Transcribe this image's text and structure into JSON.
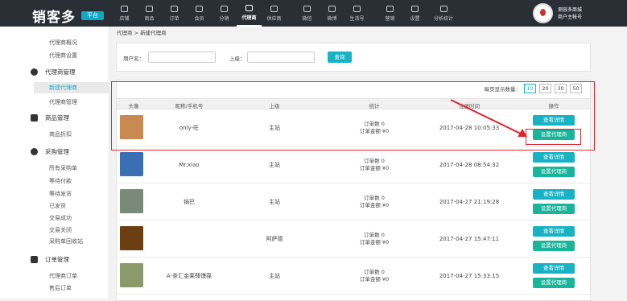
{
  "logo": {
    "text": "销客多",
    "badge": "平台"
  },
  "nav": [
    {
      "label": "店铺",
      "icon": "store-icon"
    },
    {
      "label": "商品",
      "icon": "bag-icon"
    },
    {
      "label": "订单",
      "icon": "order-icon"
    },
    {
      "label": "会员",
      "icon": "member-icon"
    },
    {
      "label": "分销",
      "icon": "distribution-icon"
    },
    {
      "label": "代理商",
      "icon": "agent-icon",
      "active": true
    },
    {
      "label": "供应商",
      "icon": "supplier-icon"
    },
    {
      "label": "微信",
      "icon": "wechat-icon"
    },
    {
      "label": "微博",
      "icon": "weibo-icon"
    },
    {
      "label": "生活号",
      "icon": "life-icon"
    },
    {
      "label": "营销",
      "icon": "marketing-icon"
    },
    {
      "label": "设置",
      "icon": "gear-icon"
    },
    {
      "label": "分析统计",
      "icon": "chart-icon"
    }
  ],
  "user": {
    "line1": "测容多商城",
    "line2": "商户主帐号"
  },
  "sidebar": {
    "items_a": [
      "代理商概况",
      "代理商设置"
    ],
    "group1": "代理商管理",
    "items_b": [
      "新建代理商",
      "代理商管理"
    ],
    "group2": "商品管理",
    "items_c": [
      "商品折扣"
    ],
    "group3": "采购管理",
    "items_d": [
      "所有采购单",
      "等待付款",
      "等待发货",
      "已发货",
      "交易成功",
      "交易关闭",
      "采购单回收站"
    ],
    "group4": "订单管理",
    "items_e": [
      "代理商订单",
      "售后订单"
    ]
  },
  "breadcrumb": "代理商 > 新建代理商",
  "filter": {
    "username_label": "用户名：",
    "username_value": "",
    "parent_label": "上级：",
    "parent_value": "",
    "search_label": "查询"
  },
  "pagesize": {
    "label": "每页显示数量：",
    "options": [
      "10",
      "20",
      "30",
      "50"
    ],
    "selected": "10"
  },
  "table": {
    "headers": [
      "头像",
      "昵称/手机号",
      "上级",
      "统计",
      "注册时间",
      "操作"
    ],
    "rows": [
      {
        "nickname": "only-旺",
        "parent": "主站",
        "orders": "订单数 0",
        "amount": "订单金额 ¥0",
        "time": "2017-04-28 10:05:33",
        "avatar_color": "#c98a52"
      },
      {
        "nickname": "Mr.xiao",
        "parent": "主站",
        "orders": "订单数 0",
        "amount": "订单金额 ¥0",
        "time": "2017-04-28 08:54:32",
        "avatar_color": "#3b6fb3"
      },
      {
        "nickname": "锅巴",
        "parent": "主站",
        "orders": "订单数 0",
        "amount": "订单金额 ¥0",
        "time": "2017-04-27 21:19:28",
        "avatar_color": "#7a8a7a"
      },
      {
        "nickname": "",
        "parent": "阿萨德",
        "orders": "订单数 0",
        "amount": "订单金额 ¥0",
        "time": "2017-04-27 15:47:11",
        "avatar_color": "#6b3f12"
      },
      {
        "nickname": "A-茶汇金莱臻馒葆",
        "parent": "主站",
        "orders": "订单数 0",
        "amount": "订单金额 ¥0",
        "time": "2017-04-27 15:33:15",
        "avatar_color": "#8a9a6a"
      }
    ],
    "btn_detail": "查看详情",
    "btn_set_agent": "设置代理商"
  },
  "colors": {
    "accent": "#17b3c5",
    "green": "#18b59a",
    "annotation": "#e0262b",
    "topbar": "#2a2f36"
  }
}
